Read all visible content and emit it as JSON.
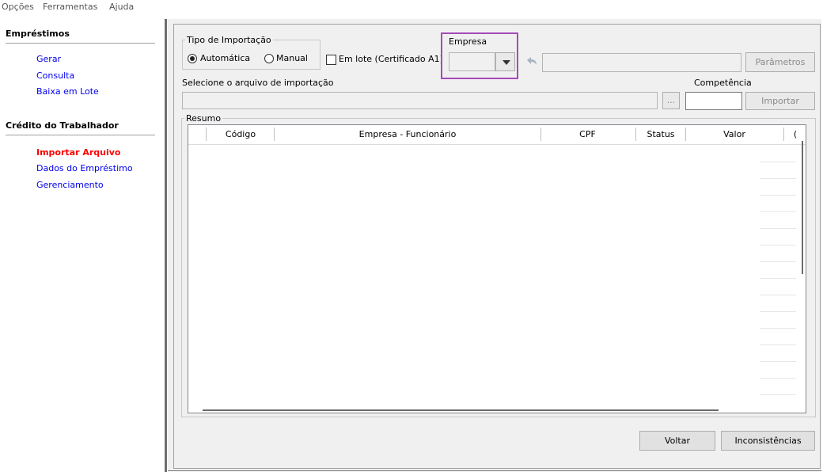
{
  "menu": [
    "Opções",
    "Ferramentas",
    "Ajuda"
  ],
  "sidebar": {
    "emprestimos": {
      "title": "Empréstimos",
      "items": [
        "Gerar",
        "Consulta",
        "Baixa em Lote"
      ]
    },
    "credito": {
      "title": "Crédito do Trabalhador",
      "items": [
        "Importar Arquivo",
        "Dados do Empréstimo",
        "Gerenciamento"
      ],
      "active_item": "Importar Arquivo"
    }
  },
  "import_type": {
    "label": "Tipo de Importação",
    "option_auto": "Automática",
    "option_manual": "Manual",
    "selected": "Automática"
  },
  "batch": {
    "label": "Em lote (Certificado A1)",
    "checked": false
  },
  "empresa": {
    "label": "Empresa",
    "value": ""
  },
  "buttons": {
    "parametros": "Parâmetros",
    "browse": "...",
    "importar": "Importar",
    "voltar": "Voltar",
    "inconsistencias": "Inconsistências"
  },
  "file": {
    "label": "Selecione o arquivo de importação",
    "value": ""
  },
  "competencia": {
    "label": "Competência",
    "value": ""
  },
  "resumo": {
    "label": "Resumo",
    "columns": [
      "Código",
      "Empresa - Funcionário",
      "CPF",
      "Status",
      "Valor",
      "("
    ],
    "rows": []
  },
  "colors": {
    "accent_highlight": "#a64ab8",
    "link": "#0000ee",
    "active_link": "#ff0000"
  }
}
